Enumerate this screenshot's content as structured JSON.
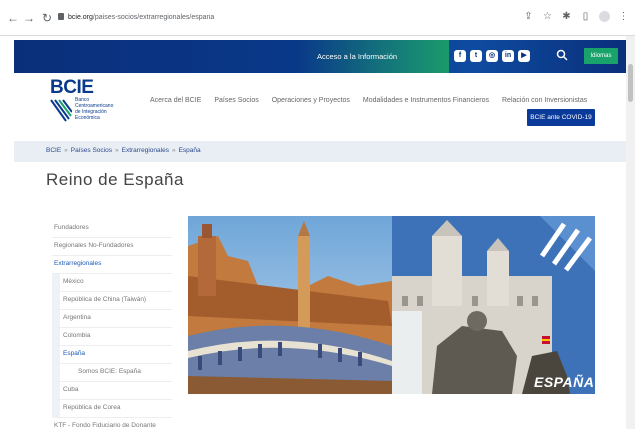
{
  "browser": {
    "url_host": "bcie.org",
    "url_path": "/paises-socios/extrarregionales/espana"
  },
  "topbar": {
    "access_label": "Acceso a la Información",
    "idiomas_label": "Idiomas",
    "social_icons": [
      "facebook-icon",
      "twitter-icon",
      "instagram-icon",
      "linkedin-icon",
      "youtube-icon"
    ]
  },
  "logo": {
    "name": "BCIE",
    "line1": "Banco",
    "line2": "Centroamericano",
    "line3": "de Integración",
    "line4": "Económica"
  },
  "nav": {
    "items": [
      "Acerca del BCIE",
      "Países Socios",
      "Operaciones y Proyectos",
      "Modalidades e Instrumentos Financieros",
      "Relación con Inversionistas"
    ],
    "covid_label": "BCIE ante COVID-19"
  },
  "breadcrumb": {
    "items": [
      "BCIE",
      "Países Socios",
      "Extrarregionales",
      "España"
    ],
    "separator": "»"
  },
  "page": {
    "title": "Reino de España"
  },
  "sidenav": {
    "items": [
      "Fundadores",
      "Regionales No-Fundadores",
      "Extrarregionales",
      "México",
      "República de China (Taiwán)",
      "Argentina",
      "Colombia",
      "España",
      "Somos BCIE: España",
      "Cuba",
      "República de Corea",
      "KTF - Fondo Fiduciario de Donante"
    ]
  },
  "banner": {
    "label": "ESPAÑA"
  },
  "colors": {
    "brand_blue": "#0a3a8c",
    "accent_green": "#19a36b",
    "link_blue": "#1a5ab4"
  }
}
